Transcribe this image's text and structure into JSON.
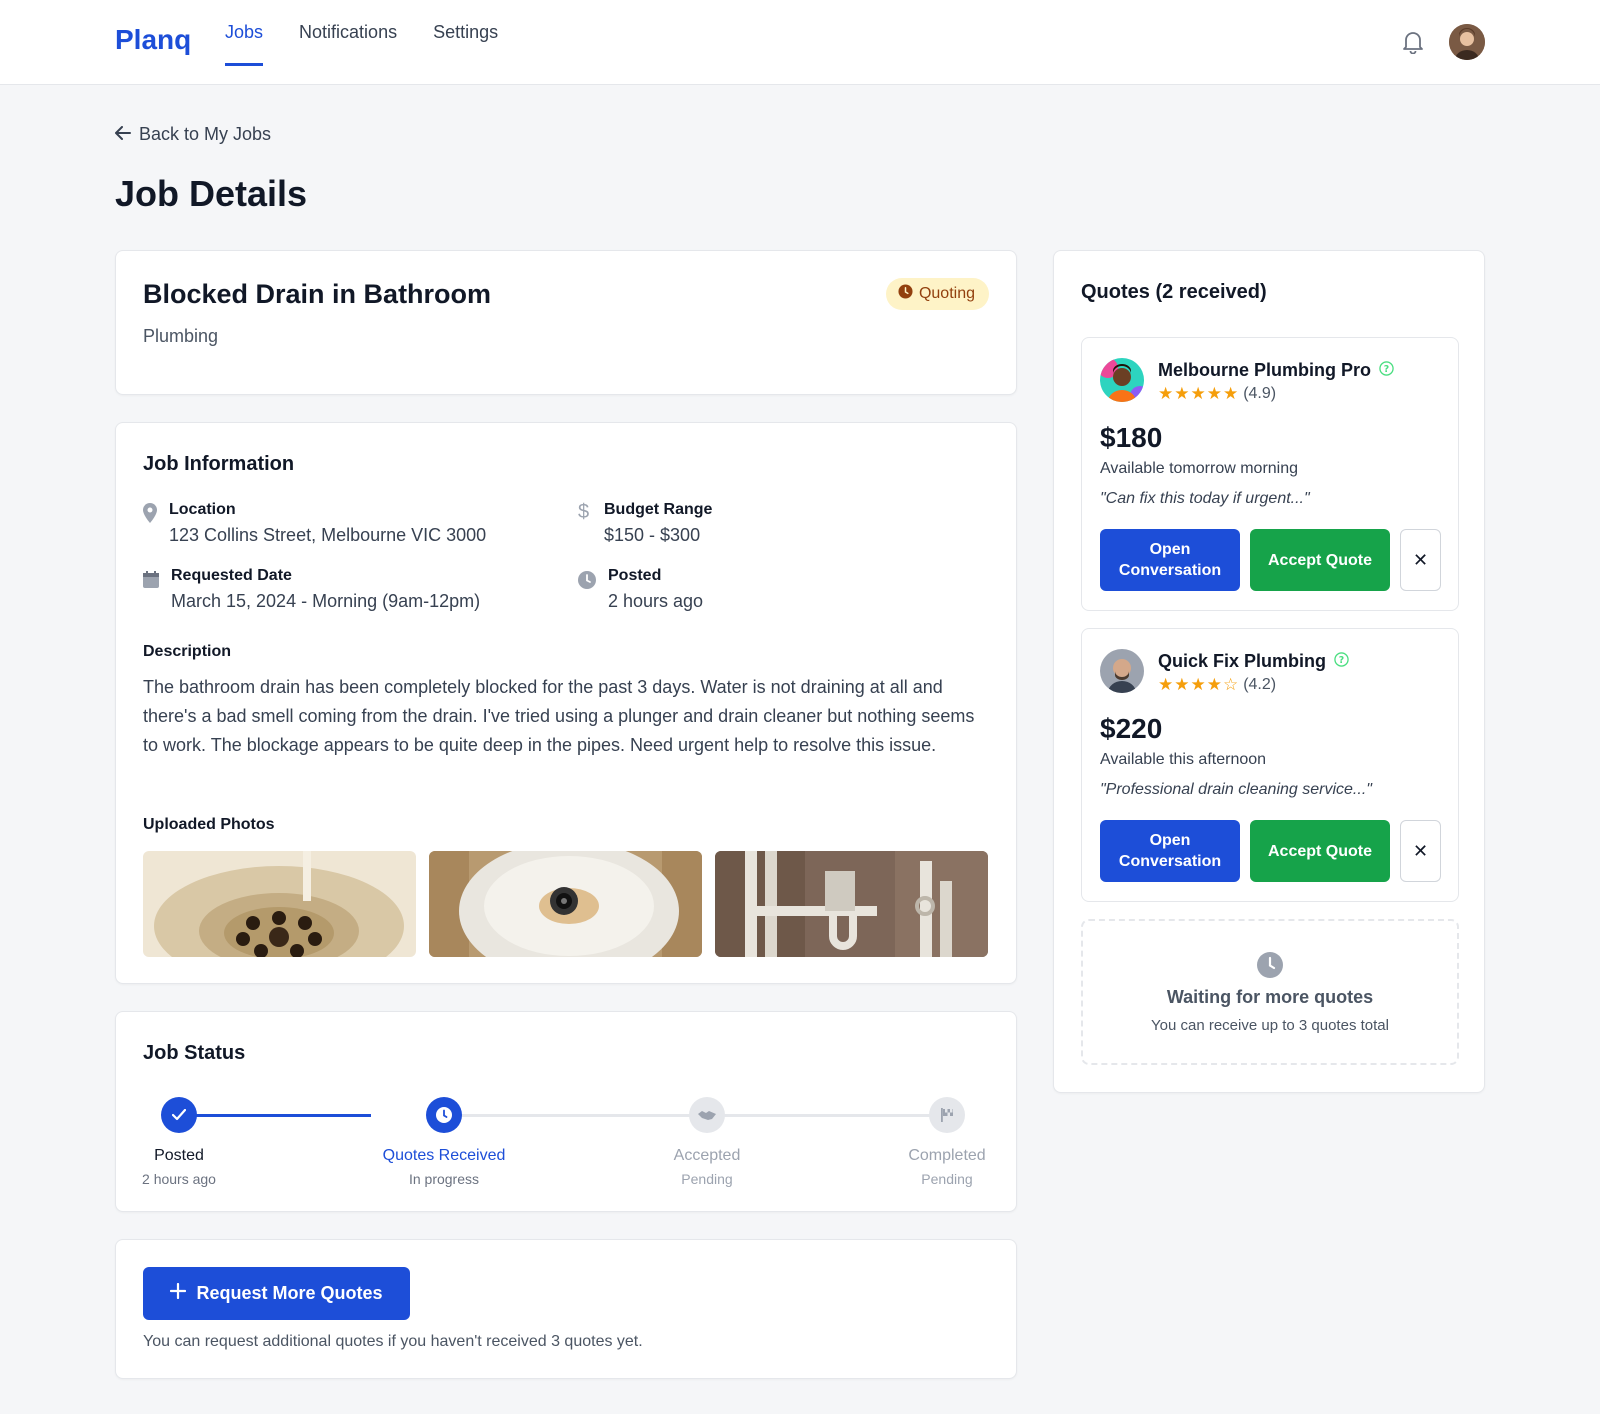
{
  "nav": {
    "logo": "Planq",
    "links": [
      "Jobs",
      "Notifications",
      "Settings"
    ],
    "active": "Jobs",
    "bell_icon": "bell-icon"
  },
  "back_label": "Back to My Jobs",
  "page_title": "Job Details",
  "job": {
    "title": "Blocked Drain in Bathroom",
    "category": "Plumbing",
    "status_badge": "Quoting"
  },
  "job_info": {
    "title": "Job Information",
    "location_label": "Location",
    "location_value": "123 Collins Street, Melbourne VIC 3000",
    "budget_label": "Budget Range",
    "budget_value": "$150 - $300",
    "date_label": "Requested Date",
    "date_value": "March 15, 2024 - Morning (9am-12pm)",
    "posted_label": "Posted",
    "posted_value": "2 hours ago",
    "description_label": "Description",
    "description": "The bathroom drain has been completely blocked for the past 3 days. Water is not draining at all and there's a bad smell coming from the drain. I've tried using a plunger and drain cleaner but nothing seems to work. The blockage appears to be quite deep in the pipes. Need urgent help to resolve this issue.",
    "photos_label": "Uploaded Photos"
  },
  "job_status": {
    "title": "Job Status",
    "steps": [
      {
        "label": "Posted",
        "sub": "2 hours ago",
        "state": "done"
      },
      {
        "label": "Quotes Received",
        "sub": "In progress",
        "state": "current"
      },
      {
        "label": "Accepted",
        "sub": "Pending",
        "state": "pending"
      },
      {
        "label": "Completed",
        "sub": "Pending",
        "state": "pending"
      }
    ]
  },
  "request": {
    "button": "Request More Quotes",
    "note": "You can request additional quotes if you haven't received 3 quotes yet."
  },
  "quotes": {
    "title": "Quotes (2 received)",
    "items": [
      {
        "name": "Melbourne Plumbing Pro",
        "stars": "★★★★★",
        "rating": "(4.9)",
        "price": "$180",
        "availability": "Available tomorrow morning",
        "message": "\"Can fix this today if urgent...\"",
        "open_label": "Open Conversation",
        "accept_label": "Accept Quote",
        "close_label": "✕"
      },
      {
        "name": "Quick Fix Plumbing",
        "stars": "★★★★☆",
        "rating": "(4.2)",
        "price": "$220",
        "availability": "Available this afternoon",
        "message": "\"Professional drain cleaning service...\"",
        "open_label": "Open Conversation",
        "accept_label": "Accept Quote",
        "close_label": "✕"
      }
    ],
    "waiting_title": "Waiting for more quotes",
    "waiting_sub": "You can receive up to 3 quotes total"
  },
  "colors": {
    "primary": "#1d4ed8",
    "success": "#16a34a",
    "badge_bg": "#fef3c7",
    "badge_text": "#92400e",
    "star": "#f59e0b"
  }
}
